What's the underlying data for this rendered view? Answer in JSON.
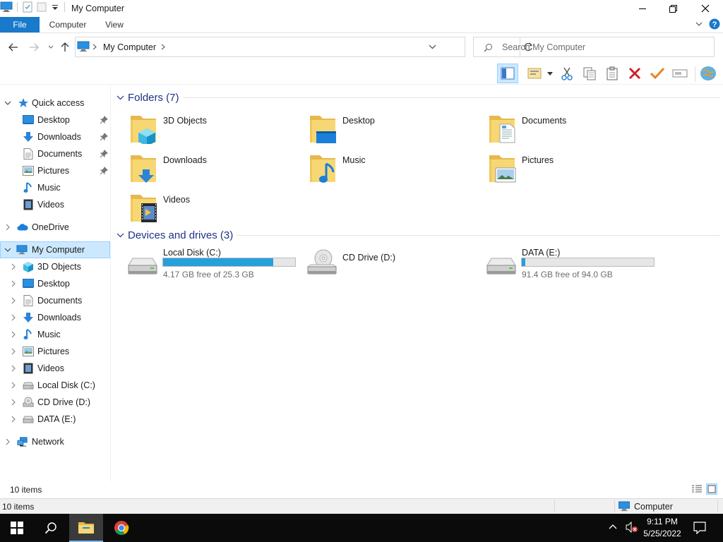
{
  "window": {
    "title": "My Computer",
    "quick_access_toolbar_icons": [
      "computer-icon",
      "properties-icon",
      "new-folder-icon",
      "customize-dropdown-icon"
    ]
  },
  "ribbon": {
    "tabs": [
      {
        "label": "File",
        "active": true
      },
      {
        "label": "Computer",
        "active": false
      },
      {
        "label": "View",
        "active": false
      }
    ]
  },
  "address_bar": {
    "path": "My Computer",
    "search_placeholder": "Search My Computer"
  },
  "toolbar": {
    "buttons": [
      "preview-pane-icon",
      "layout-icon",
      "cut-icon",
      "copy-icon",
      "paste-icon",
      "delete-icon",
      "apply-icon",
      "rename-icon",
      "globe-icon"
    ]
  },
  "nav_pane": {
    "quick_access": {
      "label": "Quick access",
      "items": [
        {
          "label": "Desktop",
          "icon": "desktop-icon",
          "pinned": true
        },
        {
          "label": "Downloads",
          "icon": "downloads-icon",
          "pinned": true
        },
        {
          "label": "Documents",
          "icon": "documents-icon",
          "pinned": true
        },
        {
          "label": "Pictures",
          "icon": "pictures-icon",
          "pinned": true
        },
        {
          "label": "Music",
          "icon": "music-icon",
          "pinned": false
        },
        {
          "label": "Videos",
          "icon": "videos-icon",
          "pinned": false
        }
      ]
    },
    "onedrive": {
      "label": "OneDrive"
    },
    "my_computer": {
      "label": "My Computer",
      "selected": true,
      "items": [
        {
          "label": "3D Objects",
          "icon": "3d-objects-icon"
        },
        {
          "label": "Desktop",
          "icon": "desktop-icon"
        },
        {
          "label": "Documents",
          "icon": "documents-icon"
        },
        {
          "label": "Downloads",
          "icon": "downloads-icon"
        },
        {
          "label": "Music",
          "icon": "music-icon"
        },
        {
          "label": "Pictures",
          "icon": "pictures-icon"
        },
        {
          "label": "Videos",
          "icon": "videos-icon"
        },
        {
          "label": "Local Disk (C:)",
          "icon": "drive-icon"
        },
        {
          "label": "CD Drive (D:)",
          "icon": "cd-drive-icon"
        },
        {
          "label": "DATA (E:)",
          "icon": "drive-icon"
        }
      ]
    },
    "network": {
      "label": "Network"
    }
  },
  "content": {
    "folders_header": "Folders (7)",
    "folders": [
      {
        "label": "3D Objects",
        "icon": "3d-objects-icon"
      },
      {
        "label": "Desktop",
        "icon": "desktop-icon"
      },
      {
        "label": "Documents",
        "icon": "documents-icon"
      },
      {
        "label": "Downloads",
        "icon": "downloads-icon"
      },
      {
        "label": "Music",
        "icon": "music-icon"
      },
      {
        "label": "Pictures",
        "icon": "pictures-icon"
      },
      {
        "label": "Videos",
        "icon": "videos-icon"
      }
    ],
    "drives_header": "Devices and drives (3)",
    "drives": [
      {
        "label": "Local Disk (C:)",
        "free_text": "4.17 GB free of 25.3 GB",
        "used_fraction": 0.835,
        "has_bar": true
      },
      {
        "label": "CD Drive (D:)",
        "free_text": "",
        "used_fraction": null,
        "has_bar": false
      },
      {
        "label": "DATA (E:)",
        "free_text": "91.4 GB free of 94.0 GB",
        "used_fraction": 0.028,
        "has_bar": true
      }
    ]
  },
  "status": {
    "items_count": "10 items",
    "bottom_items": "10 items",
    "location": "Computer"
  },
  "taskbar": {
    "time": "9:11 PM",
    "date": "5/25/2022",
    "apps": [
      "start-icon",
      "search-icon",
      "file-explorer-icon",
      "chrome-icon"
    ]
  },
  "colors": {
    "accent": "#1979ca",
    "bar_fill": "#26a0da",
    "selection": "#cce8ff",
    "group_header": "#1e3287"
  }
}
